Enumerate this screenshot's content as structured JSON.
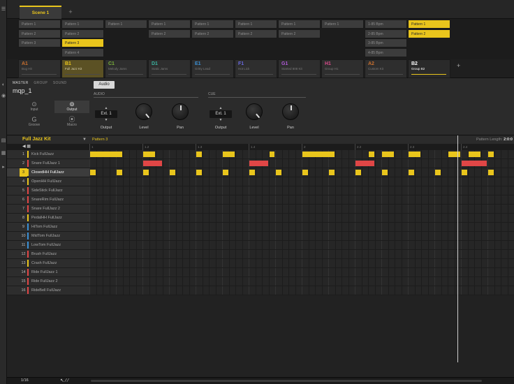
{
  "scene": {
    "tab": "Scene 1",
    "add": "+"
  },
  "patterns": {
    "columns": [
      [
        "Pattern 1",
        "Pattern 2",
        "Pattern 3"
      ],
      [
        "Pattern 1",
        "Pattern 2",
        "Pattern 3",
        "Pattern 4"
      ],
      [
        "Pattern 1"
      ],
      [
        "Pattern 1",
        "Pattern 2"
      ],
      [
        "Pattern 1",
        "Pattern 2"
      ],
      [
        "Pattern 1",
        "Pattern 2"
      ],
      [
        "Pattern 1",
        "Pattern 2"
      ],
      [
        "Pattern 1"
      ],
      [
        "1-85 Bpm",
        "2-85 Bpm",
        "3-85 Bpm",
        "4-85 Bpm"
      ],
      [
        "Pattern 1",
        "Pattern 2"
      ]
    ],
    "selected": [
      [
        1,
        2
      ],
      [
        9,
        0
      ],
      [
        9,
        1
      ]
    ]
  },
  "groups": [
    {
      "letter": "A1",
      "name": "Bug Hit",
      "color": "#c9702f"
    },
    {
      "letter": "B1",
      "name": "Full Jazz Kit",
      "color": "#e9c51c"
    },
    {
      "letter": "C1",
      "name": "Melody Jams",
      "color": "#7bb33b"
    },
    {
      "letter": "D1",
      "name": "Static Jams",
      "color": "#3bb3a0"
    },
    {
      "letter": "E1",
      "name": "Gritty Lead",
      "color": "#3b8fd4"
    },
    {
      "letter": "F1",
      "name": "Hot Lick",
      "color": "#6a6ae0"
    },
    {
      "letter": "G1",
      "name": "Started 808 Kit",
      "color": "#b15ad8"
    },
    {
      "letter": "H1",
      "name": "Group H1",
      "color": "#d84a8a"
    },
    {
      "letter": "A2",
      "name": "Custom Kit",
      "color": "#c9702f"
    },
    {
      "letter": "B2",
      "name": "Group B2",
      "color": "#ffffff"
    }
  ],
  "group_add": "+",
  "channel": {
    "tabs": [
      "MASTER",
      "GROUP",
      "SOUND"
    ],
    "active_tab": "MASTER",
    "name": "mqp_1",
    "page_buttons": [
      {
        "label": "Input",
        "icon": "⊙"
      },
      {
        "label": "Output",
        "icon": "⊚"
      },
      {
        "label": "Groove",
        "icon": "G"
      },
      {
        "label": "Macro",
        "icon": "⦿"
      }
    ],
    "active_page": "Output",
    "audio_tab": "Audio",
    "audio": {
      "section": "AUDIO",
      "output_value": "Ext. 1",
      "output_label": "Output",
      "level_label": "Level",
      "pan_label": "Pan"
    },
    "cue": {
      "section": "CUE",
      "output_value": "Ext. 1",
      "output_label": "Output",
      "level_label": "Level",
      "pan_label": "Pan"
    }
  },
  "sequencer": {
    "kit_name": "Full Jazz Kit",
    "pattern_name": "Pattern 3",
    "pattern_length_label": "Pattern Length:",
    "pattern_length_value": "2:0:0",
    "ruler": [
      "1",
      "1.2",
      "1.3",
      "1.4",
      "2",
      "2.2",
      "2.3",
      "2.4"
    ],
    "sounds": [
      {
        "num": "1",
        "name": "Kick FullJazz",
        "color": "#e9c51c"
      },
      {
        "num": "2",
        "name": "Snare FullJazz 1",
        "color": "#e04646"
      },
      {
        "num": "3",
        "name": "ClosedHH FullJazz",
        "color": "#e9c51c"
      },
      {
        "num": "4",
        "name": "OpenHH FullJazz",
        "color": "#e9c51c"
      },
      {
        "num": "5",
        "name": "SideStick FullJazz",
        "color": "#e04646"
      },
      {
        "num": "6",
        "name": "SnareRim FullJazz",
        "color": "#e04646"
      },
      {
        "num": "7",
        "name": "Snare FullJazz 2",
        "color": "#e04646"
      },
      {
        "num": "8",
        "name": "PedalHH FullJazz",
        "color": "#e9c51c"
      },
      {
        "num": "9",
        "name": "HiTom FullJazz",
        "color": "#3b8fd4"
      },
      {
        "num": "10",
        "name": "MidTom FullJazz",
        "color": "#3b8fd4"
      },
      {
        "num": "11",
        "name": "LowTom FullJazz",
        "color": "#3b8fd4"
      },
      {
        "num": "12",
        "name": "Brush FullJazz",
        "color": "#e04646"
      },
      {
        "num": "13",
        "name": "Crash FullJazz",
        "color": "#e9c51c"
      },
      {
        "num": "14",
        "name": "Ride FullJazz 1",
        "color": "#e04646"
      },
      {
        "num": "15",
        "name": "Ride FullJazz 2",
        "color": "#e04646"
      },
      {
        "num": "16",
        "name": "RideBell FullJazz",
        "color": "#e04646"
      }
    ],
    "selected_sound": 3,
    "notes": [
      {
        "row": 1,
        "start": 0,
        "len": 5
      },
      {
        "row": 1,
        "start": 8,
        "len": 2
      },
      {
        "row": 1,
        "start": 16,
        "len": 1
      },
      {
        "row": 1,
        "start": 20,
        "len": 2
      },
      {
        "row": 1,
        "start": 27,
        "len": 1
      },
      {
        "row": 1,
        "start": 32,
        "len": 5
      },
      {
        "row": 1,
        "start": 42,
        "len": 1
      },
      {
        "row": 1,
        "start": 44,
        "len": 2
      },
      {
        "row": 1,
        "start": 48,
        "len": 2
      },
      {
        "row": 1,
        "start": 54,
        "len": 2
      },
      {
        "row": 1,
        "start": 57,
        "len": 2
      },
      {
        "row": 1,
        "start": 60,
        "len": 1
      },
      {
        "row": 2,
        "start": 8,
        "len": 3
      },
      {
        "row": 2,
        "start": 24,
        "len": 3
      },
      {
        "row": 2,
        "start": 40,
        "len": 3
      },
      {
        "row": 2,
        "start": 56,
        "len": 4
      },
      {
        "row": 3,
        "start": 0,
        "len": 1
      },
      {
        "row": 3,
        "start": 4,
        "len": 1
      },
      {
        "row": 3,
        "start": 8,
        "len": 1
      },
      {
        "row": 3,
        "start": 12,
        "len": 1
      },
      {
        "row": 3,
        "start": 16,
        "len": 1
      },
      {
        "row": 3,
        "start": 20,
        "len": 1
      },
      {
        "row": 3,
        "start": 24,
        "len": 1
      },
      {
        "row": 3,
        "start": 28,
        "len": 1
      },
      {
        "row": 3,
        "start": 32,
        "len": 1
      },
      {
        "row": 3,
        "start": 36,
        "len": 1
      },
      {
        "row": 3,
        "start": 40,
        "len": 1
      },
      {
        "row": 3,
        "start": 44,
        "len": 1
      },
      {
        "row": 3,
        "start": 48,
        "len": 1
      },
      {
        "row": 3,
        "start": 52,
        "len": 1
      },
      {
        "row": 3,
        "start": 56,
        "len": 1
      },
      {
        "row": 3,
        "start": 60,
        "len": 1
      }
    ],
    "steps": 64,
    "playhead_step": 55.5
  },
  "footer": {
    "step": "1/16",
    "tools": "↖ ⁄ ⁄"
  },
  "accent": "#e9c51c"
}
